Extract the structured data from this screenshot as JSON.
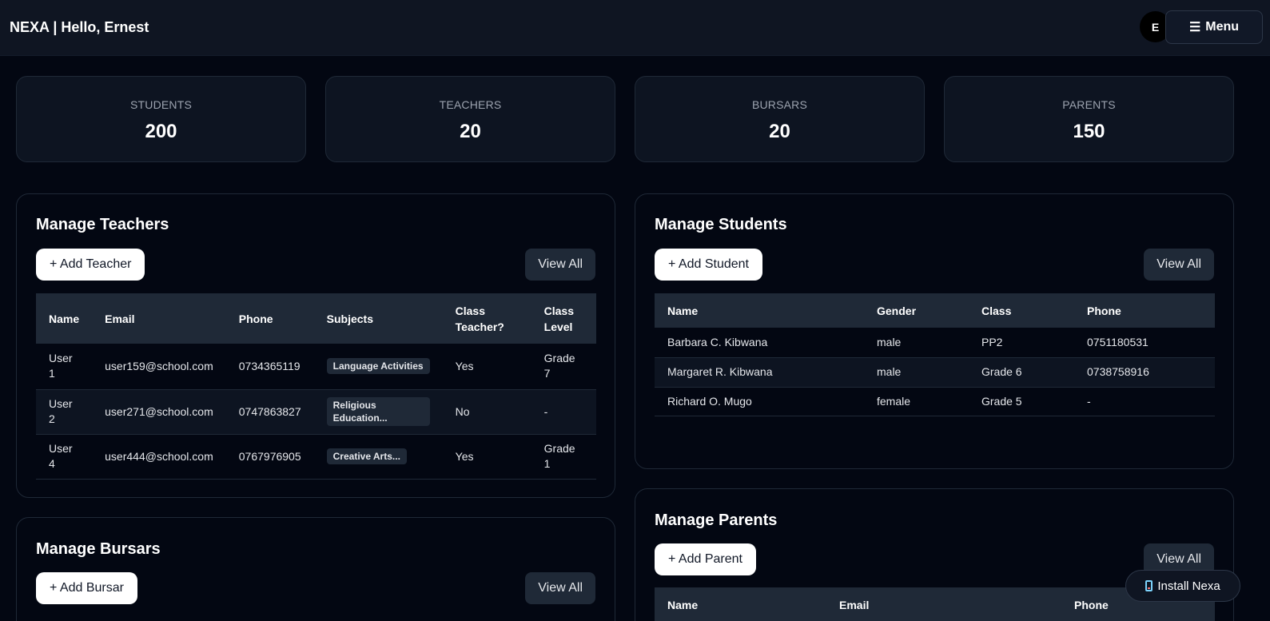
{
  "header": {
    "brand": "NEXA | Hello, Ernest",
    "avatar_initial": "E",
    "menu_icon": "☰",
    "menu_label": "Menu"
  },
  "stats": [
    {
      "label": "STUDENTS",
      "value": "200"
    },
    {
      "label": "TEACHERS",
      "value": "20"
    },
    {
      "label": "BURSARS",
      "value": "20"
    },
    {
      "label": "PARENTS",
      "value": "150"
    }
  ],
  "teachers": {
    "title": "Manage Teachers",
    "add_label": "+ Add Teacher",
    "view_all_label": "View All",
    "columns": [
      "Name",
      "Email",
      "Phone",
      "Subjects",
      "Class Teacher?",
      "Class Level"
    ],
    "rows": [
      {
        "name": "User 1",
        "email": "user159@school.com",
        "phone": "0734365119",
        "subjects": "Language Activities",
        "class_teacher": "Yes",
        "class_level": "Grade 7"
      },
      {
        "name": "User 2",
        "email": "user271@school.com",
        "phone": "0747863827",
        "subjects": "Religious Education...",
        "class_teacher": "No",
        "class_level": "-"
      },
      {
        "name": "User 4",
        "email": "user444@school.com",
        "phone": "0767976905",
        "subjects": "Creative Arts...",
        "class_teacher": "Yes",
        "class_level": "Grade 1"
      }
    ]
  },
  "students": {
    "title": "Manage Students",
    "add_label": "+ Add Student",
    "view_all_label": "View All",
    "columns": [
      "Name",
      "Gender",
      "Class",
      "Phone"
    ],
    "rows": [
      {
        "name": "Barbara C. Kibwana",
        "gender": "male",
        "class": "PP2",
        "phone": "0751180531"
      },
      {
        "name": "Margaret R. Kibwana",
        "gender": "male",
        "class": "Grade 6",
        "phone": "0738758916"
      },
      {
        "name": "Richard O. Mugo",
        "gender": "female",
        "class": "Grade 5",
        "phone": "-"
      }
    ]
  },
  "bursars": {
    "title": "Manage Bursars",
    "add_label": "+ Add Bursar",
    "view_all_label": "View All"
  },
  "parents": {
    "title": "Manage Parents",
    "add_label": "+ Add Parent",
    "view_all_label": "View All",
    "columns": [
      "Name",
      "Email",
      "Phone"
    ]
  },
  "install": {
    "label": "Install Nexa",
    "icon": "phone-icon"
  }
}
